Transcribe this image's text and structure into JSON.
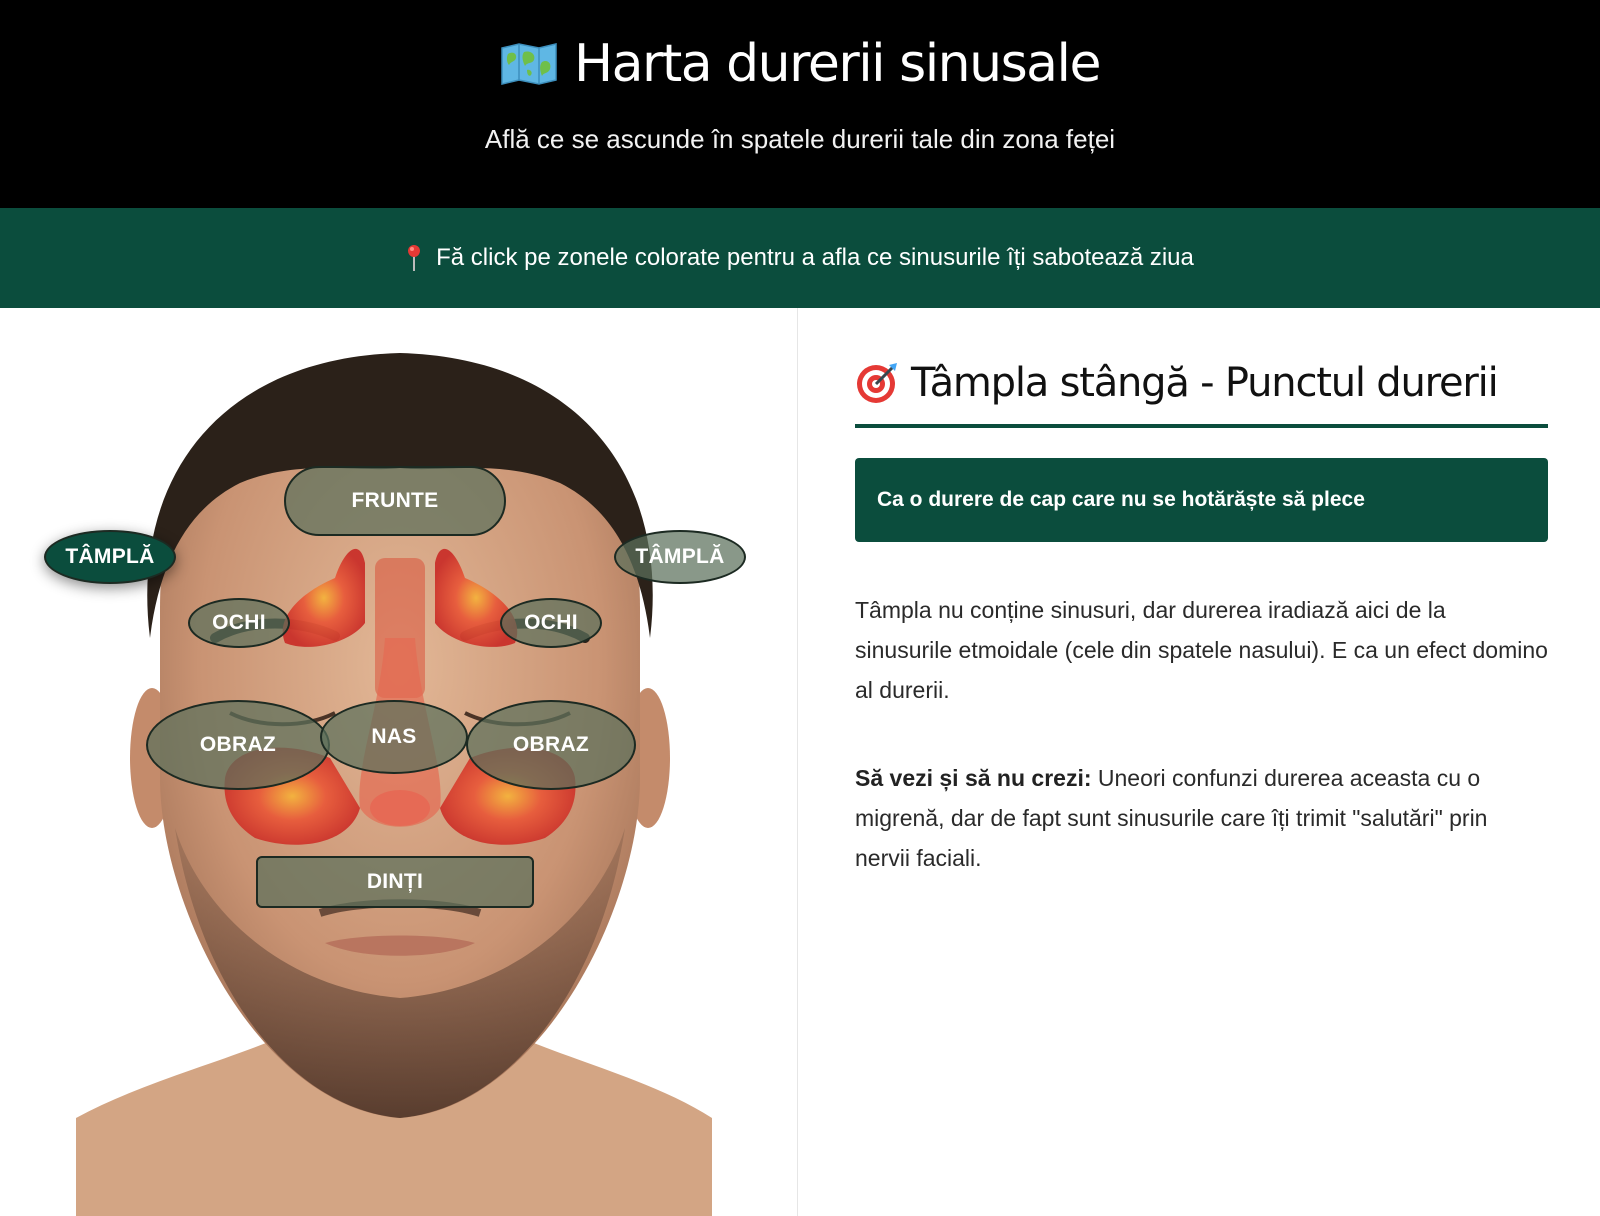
{
  "header": {
    "title": "Harta durerii sinusale",
    "title_icon": "world-map-icon",
    "subtitle": "Află ce se ascunde în spatele durerii tale din zona feței"
  },
  "banner": {
    "icon": "round-pushpin-icon",
    "text": "Fă click pe zonele colorate pentru a afla ce sinusurile îți sabotează ziua"
  },
  "face_map": {
    "zones": {
      "frunte": "FRUNTE",
      "tampla_stanga": "TÂMPLĂ",
      "tampla_dreapta": "TÂMPLĂ",
      "ochi_stang": "OCHI",
      "ochi_drept": "OCHI",
      "obraz_stang": "OBRAZ",
      "nas": "NAS",
      "obraz_drept": "OBRAZ",
      "dinti": "DINȚI"
    },
    "active_zone": "tampla_stanga"
  },
  "detail": {
    "icon": "direct-hit-target-icon",
    "title": "Tâmpla stângă - Punctul durerii",
    "tagline": "Ca o durere de cap care nu se hotărăște să plece",
    "paragraph1": "Tâmpla nu conține sinusuri, dar durerea iradiază aici de la sinusurile etmoidale (cele din spatele nasului). E ca un efect domino al durerii.",
    "paragraph2_lead": "Să vezi și să nu crezi:",
    "paragraph2_text": " Uneori confunzi durerea aceasta cu o migrenă, dar de fapt sunt sinusurile care îți trimit \"salutări\" prin nervii faciali."
  },
  "colors": {
    "header_bg": "#000000",
    "accent_green": "#0b4d3d",
    "zone_overlay": "#5c705c",
    "sinus_red": "#e0473a"
  }
}
